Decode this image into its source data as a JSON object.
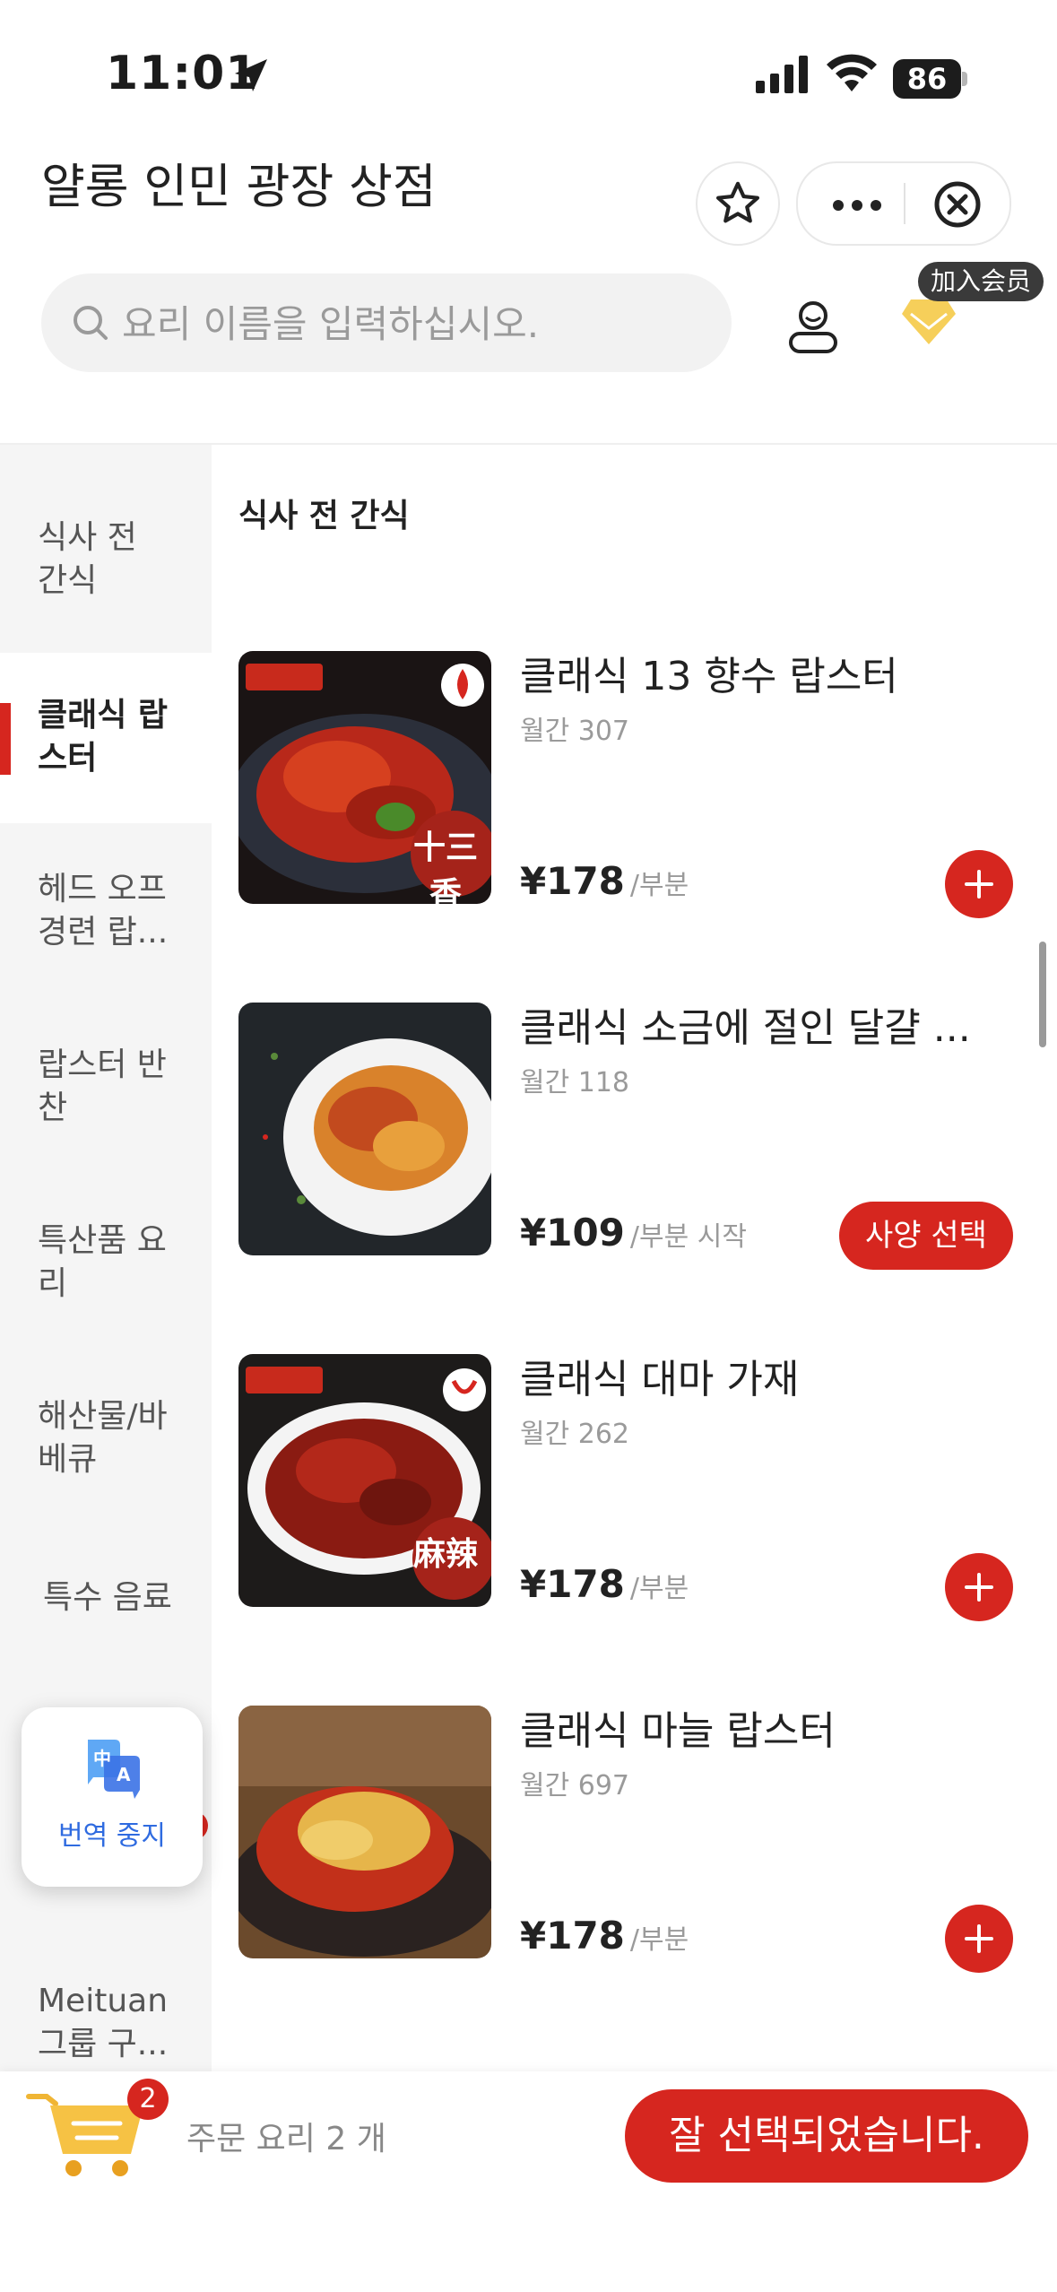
{
  "status_bar": {
    "time": "11:01",
    "battery": "86"
  },
  "header": {
    "store_name": "얄롱 인민 광장 상점",
    "search_placeholder": "요리 이름을 입력하십시오.",
    "member_badge": "加入会员"
  },
  "sidebar": {
    "items": [
      {
        "label": "식사 전 간식"
      },
      {
        "label": "클래식 랍스터"
      },
      {
        "label": "헤드 오프 경련 랍..."
      },
      {
        "label": "랍스터 반찬"
      },
      {
        "label": "특산품 요리"
      },
      {
        "label": "해산물/바베큐"
      },
      {
        "label": "특수 음료"
      },
      {
        "label": "Meituan 그룹 구..."
      }
    ],
    "active_index": 1
  },
  "translate_popup": {
    "label": "번역 중지"
  },
  "section_title": "식사 전 간식",
  "items": [
    {
      "name": "클래식 13 향수 랍스터",
      "sales": "월간 307",
      "currency": "¥",
      "price": "178",
      "unit": "/부분",
      "action": "add",
      "badge": "十三香"
    },
    {
      "name": "클래식 소금에 절인 달걀 ...",
      "sales": "월간 118",
      "currency": "¥",
      "price": "109",
      "unit": "/부분 시작",
      "action": "spec",
      "spec_label": "사양 선택"
    },
    {
      "name": "클래식 대마 가재",
      "sales": "월간 262",
      "currency": "¥",
      "price": "178",
      "unit": "/부분",
      "action": "add",
      "badge": "麻辣"
    },
    {
      "name": "클래식 마늘 랍스터",
      "sales": "월간 697",
      "currency": "¥",
      "price": "178",
      "unit": "/부분",
      "action": "add"
    }
  ],
  "cart": {
    "count": "2",
    "text": "주문 요리 2 개",
    "checkout_label": "잘 선택되었습니다."
  },
  "colors": {
    "accent": "#d6261f",
    "sidebar_bg": "#f5f5f5",
    "badge_bg": "#3a3a3a"
  }
}
